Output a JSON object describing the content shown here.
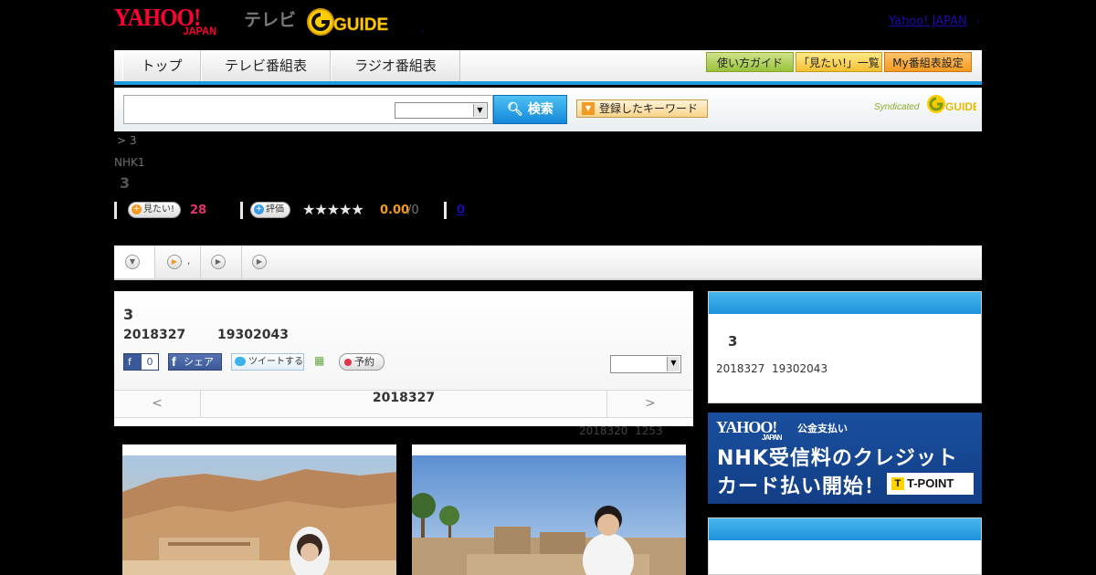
{
  "header": {
    "yahoo_logo": "YAHOO!",
    "yahoo_japan": "JAPAN",
    "tv_word": "テレビ",
    "gguide_logo": "G-GUIDE",
    "yahoo_japan_link": "Yahoo! JAPAN",
    "separator_dot": ",",
    "tiny_dot": ","
  },
  "nav": {
    "tabs": [
      {
        "label": "トップ"
      },
      {
        "label": "テレビ番組表"
      },
      {
        "label": "ラジオ番組表"
      }
    ],
    "buttons": [
      {
        "label": "使い方ガイド"
      },
      {
        "label": "「見たい!」一覧"
      },
      {
        "label": "My番組表設定"
      }
    ],
    "accent_color": "#1e9be0"
  },
  "search": {
    "input_value": "",
    "select_value": "",
    "search_button": "検索",
    "keyword_button": "登録したキーワード",
    "syndicated": "Syndicated",
    "syndicated_logo": "G-GUIDE"
  },
  "breadcrumb": {
    "text": ">  3"
  },
  "program": {
    "channel": "NHK1",
    "number": "3",
    "want_label": "見たい!",
    "want_count": "28",
    "rate_label": "評価",
    "stars": "★★★★★",
    "score": "0.00",
    "score_denominator": "/0",
    "review_count": "0"
  },
  "tabstrip": {
    "tab2_label": ","
  },
  "detail": {
    "title": "3",
    "date": "2018327",
    "time": "19302043",
    "fb_like_count": "0",
    "fb_share": "シェア",
    "tweet": "ツイートする",
    "reserve": "予約",
    "select_value": "",
    "prev": "<",
    "current_date": "2018327",
    "next": ">",
    "updated_date": "2018320",
    "updated_time": "1253"
  },
  "sidebar": {
    "title": "3",
    "date": "2018327",
    "time": "19302043"
  },
  "banner": {
    "logo": "YAHOO!",
    "logo_sub": "JAPAN",
    "service": "公金支払い",
    "line1": "NHK受信料のクレジット",
    "line2": "カード払い開始！",
    "tpoint": "T-POINT",
    "tpoint_mark": "T"
  },
  "icons": {
    "search": "search-icon",
    "triangle": "triangle-icon",
    "play": "play-icon"
  }
}
